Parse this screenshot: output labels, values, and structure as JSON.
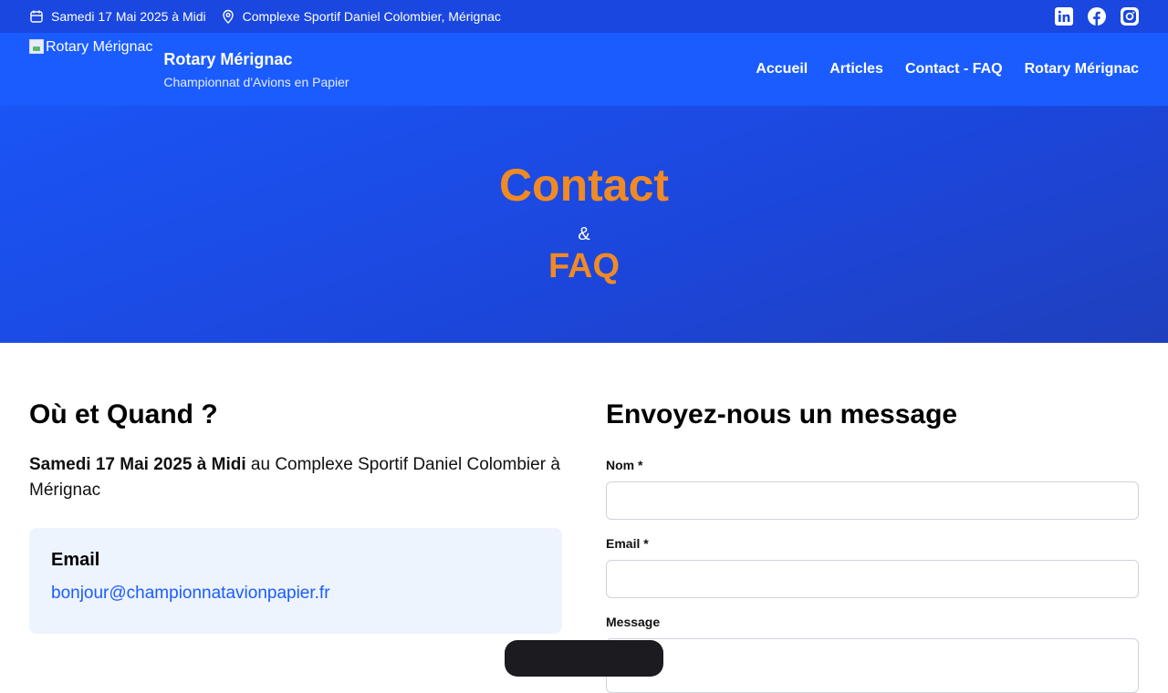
{
  "topbar": {
    "date": "Samedi 17 Mai 2025 à Midi",
    "location": "Complexe Sportif Daniel Colombier, Mérignac",
    "social": [
      "linkedin-icon",
      "facebook-icon",
      "instagram-icon"
    ]
  },
  "header": {
    "logo_alt": "Rotary Mérignac",
    "brand_name": "Rotary Mérignac",
    "tagline": "Championnat d'Avions en Papier",
    "nav": [
      "Accueil",
      "Articles",
      "Contact - FAQ",
      "Rotary Mérignac"
    ]
  },
  "hero": {
    "title": "Contact",
    "amp": "&",
    "subtitle": "FAQ"
  },
  "info": {
    "heading": "Où et Quand ?",
    "when_bold": "Samedi 17 Mai 2025 à Midi",
    "when_rest": " au Complexe Sportif Daniel Colombier à Mérignac",
    "email_title": "Email",
    "email_address": "bonjour@championnatavionpapier.fr"
  },
  "form": {
    "heading": "Envoyez-nous un message",
    "name_label": "Nom *",
    "email_label": "Email *",
    "message_label": "Message"
  },
  "colors": {
    "topbar": "#1a47e0",
    "header": "#1a5cff",
    "accent": "#f08a24",
    "link": "#1a5cff",
    "card": "#eef4fd"
  }
}
